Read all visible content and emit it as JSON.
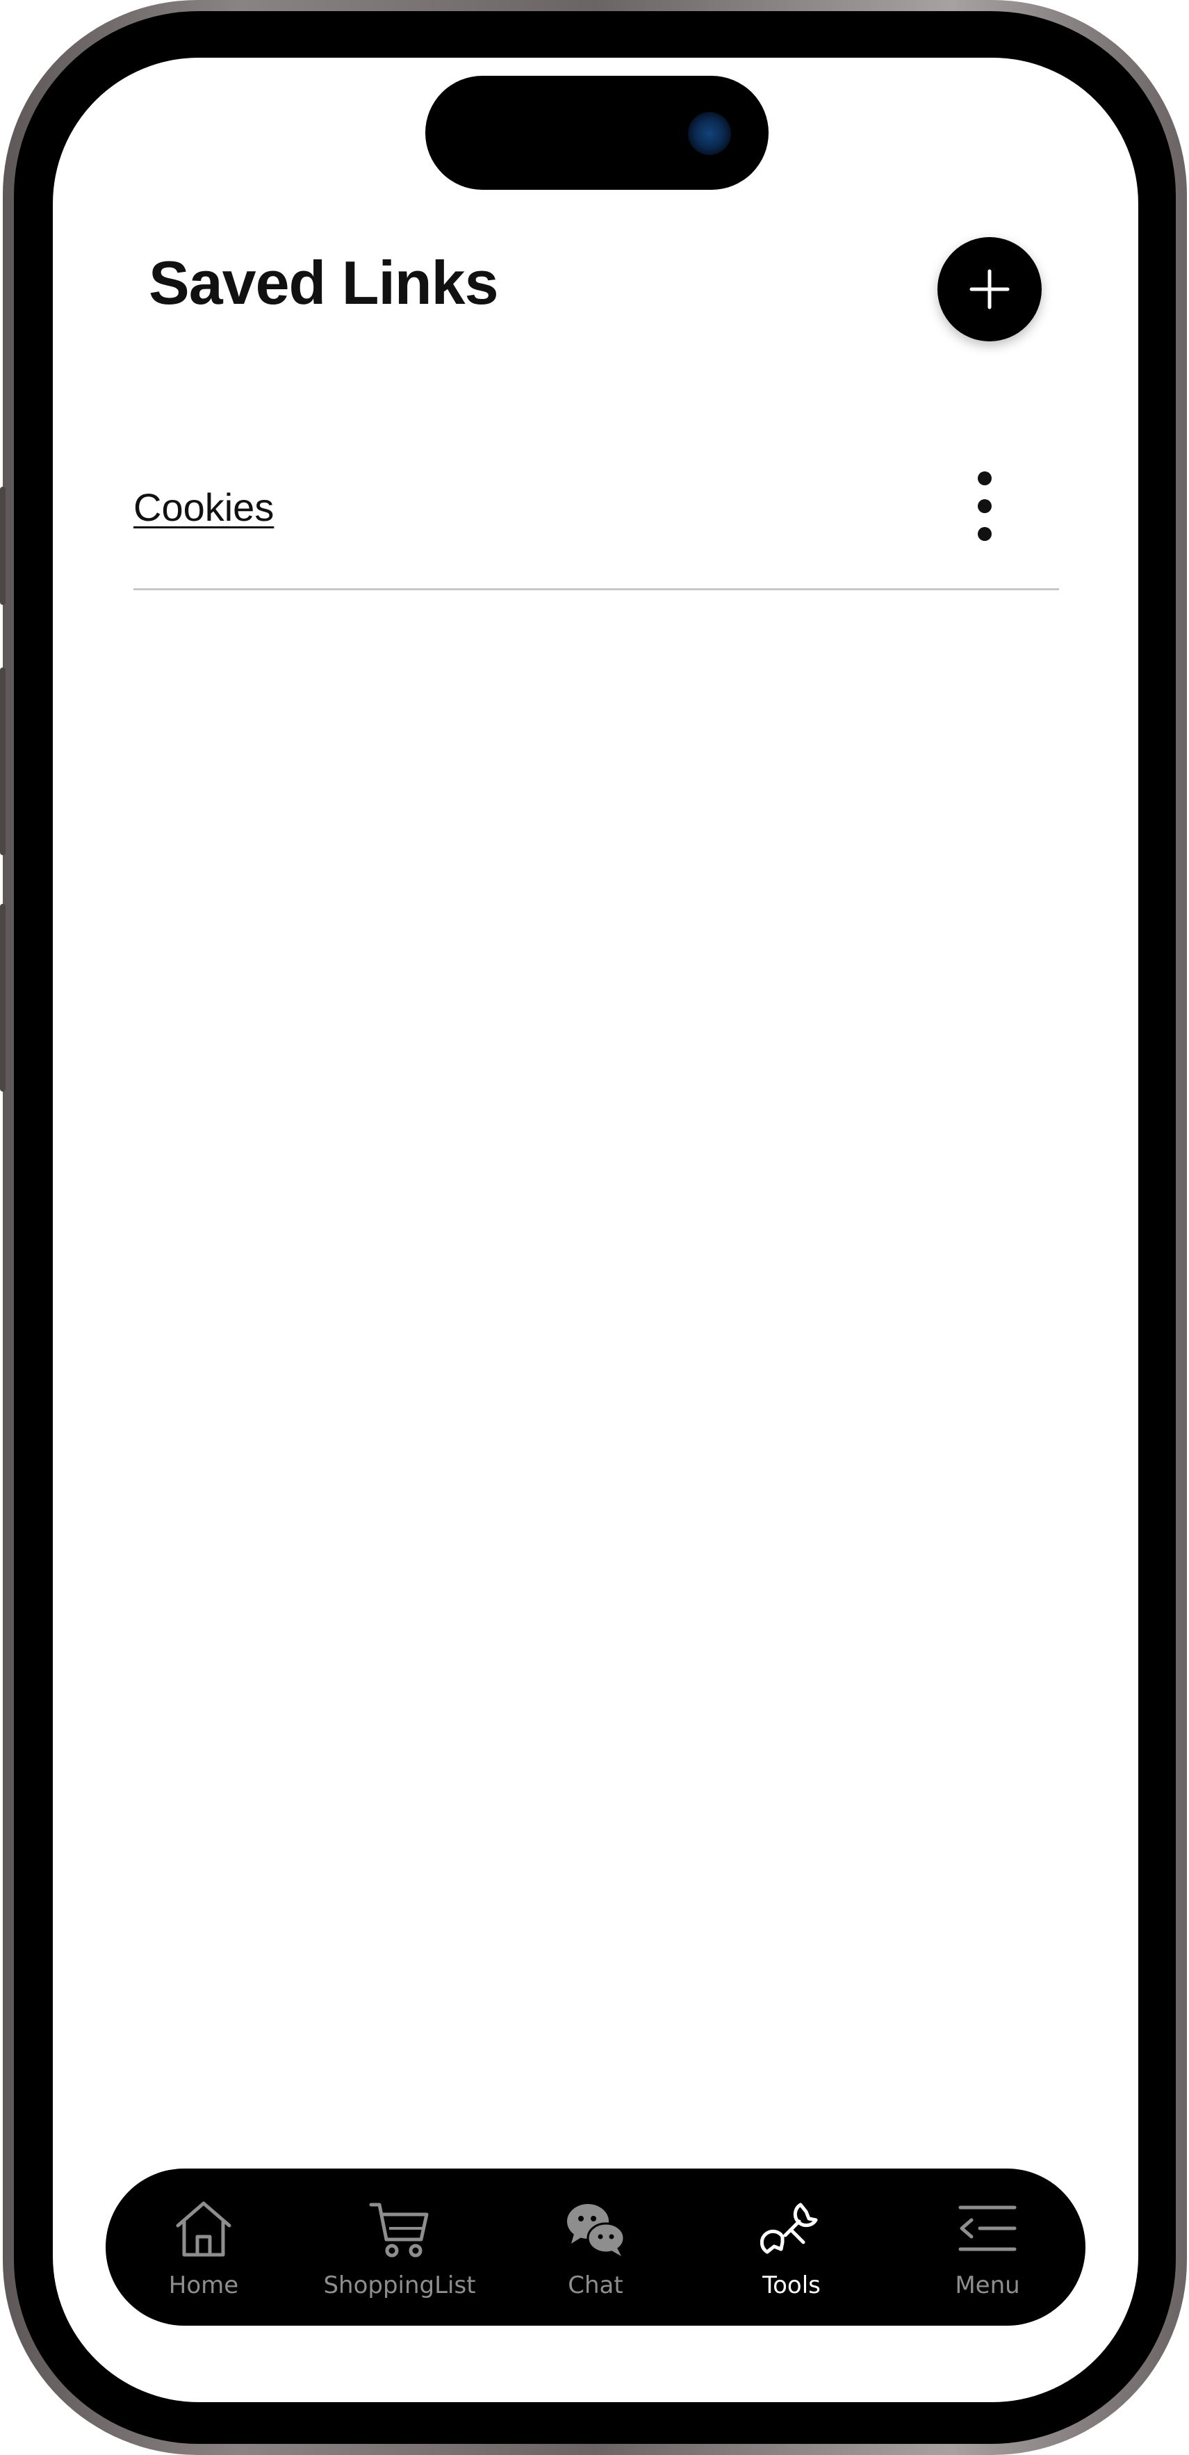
{
  "page": {
    "title": "Saved Links",
    "add_button_label": "+"
  },
  "links": [
    {
      "label": "Cookies"
    }
  ],
  "tab_bar": {
    "active": "Tools",
    "tabs": [
      {
        "label": "Home",
        "icon": "home-icon"
      },
      {
        "label": "ShoppingList",
        "icon": "cart-icon"
      },
      {
        "label": "Chat",
        "icon": "chat-bubbles-icon"
      },
      {
        "label": "Tools",
        "icon": "wrench-icon"
      },
      {
        "label": "Menu",
        "icon": "menu-icon"
      }
    ]
  },
  "colors": {
    "accent": "#000000",
    "tab_inactive": "#8e8e8e",
    "tab_active": "#ffffff",
    "divider": "#c8c8c8"
  }
}
